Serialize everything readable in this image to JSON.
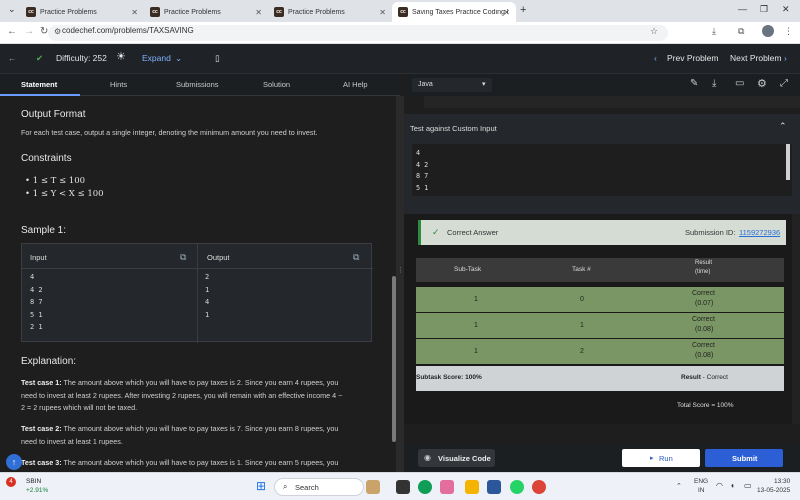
{
  "browser": {
    "tabs": [
      {
        "label": "Practice Problems",
        "icon": "cc"
      },
      {
        "label": "Practice Problems",
        "icon": "cc"
      },
      {
        "label": "Practice Problems",
        "icon": "cc"
      },
      {
        "label": "Saving Taxes Practice Coding P",
        "icon": "cc",
        "active": true
      }
    ],
    "url": "codechef.com/problems/TAXSAVING"
  },
  "header": {
    "difficulty": "Difficulty: 252",
    "expand": "Expand",
    "prev": "Prev Problem",
    "next": "Next Problem"
  },
  "left_tabs": [
    "Statement",
    "Hints",
    "Submissions",
    "Solution",
    "AI Help"
  ],
  "statement": {
    "output_format_title": "Output Format",
    "output_format_text": "For each test case, output a single integer, denoting the minimum amount you need to invest.",
    "constraints_title": "Constraints",
    "constraints": [
      "1 ≤ T ≤ 100",
      "1 ≤ Y < X ≤ 100"
    ],
    "sample_title": "Sample 1:",
    "sample_input_label": "Input",
    "sample_output_label": "Output",
    "sample_input_lines": [
      "4",
      "4 2",
      "8 7",
      "5 1",
      "2 1"
    ],
    "sample_output_lines": [
      "2",
      "1",
      "4",
      "1"
    ],
    "explanation_title": "Explanation:",
    "explanations": [
      {
        "label": "Test case 1:",
        "text": " The amount above which you will have to pay taxes is 2. Since you earn 4 rupees, you",
        "line2": "need to invest at least 2 rupees. After investing 2 rupees, you will remain with an effective income 4 −",
        "line3": "2 = 2 rupees which will not be taxed."
      },
      {
        "label": "Test case 2:",
        "text": " The amount above which you will have to pay taxes is 7. Since you earn 8 rupees, you",
        "line2": "need to invest at least 1 rupees."
      },
      {
        "label": "Test case 3:",
        "text": " The amount above which you will have to pay taxes is 1. Since you earn 5 rupees, you"
      }
    ]
  },
  "editor": {
    "language": "Java",
    "custom_input_title": "Test against Custom Input",
    "custom_input_lines": [
      "4",
      "4 2",
      "8 7",
      "5 1"
    ]
  },
  "result": {
    "status": "Correct Answer",
    "submission_label": "Submission ID:",
    "submission_id": "1159272936",
    "columns": [
      "Sub-Task",
      "Task #",
      "Result",
      "(time)"
    ],
    "rows": [
      {
        "subtask": "1",
        "task": "0",
        "result": "Correct",
        "time": "(0.07)"
      },
      {
        "subtask": "1",
        "task": "1",
        "result": "Correct",
        "time": "(0.08)"
      },
      {
        "subtask": "1",
        "task": "2",
        "result": "Correct",
        "time": "(0.08)"
      }
    ],
    "subtask_score": "Subtask Score: 100%",
    "result_label": "Result",
    "result_value": " - Correct",
    "total_score": "Total Score = 100%"
  },
  "buttons": {
    "visualize": "Visualize Code",
    "run": "Run",
    "submit": "Submit"
  },
  "taskbar": {
    "stock_name": "SBIN",
    "stock_change": "+2.91%",
    "search": "Search",
    "lang": "ENG",
    "region": "IN",
    "time": "13:30",
    "date": "13-05-2025",
    "badge": "4"
  }
}
